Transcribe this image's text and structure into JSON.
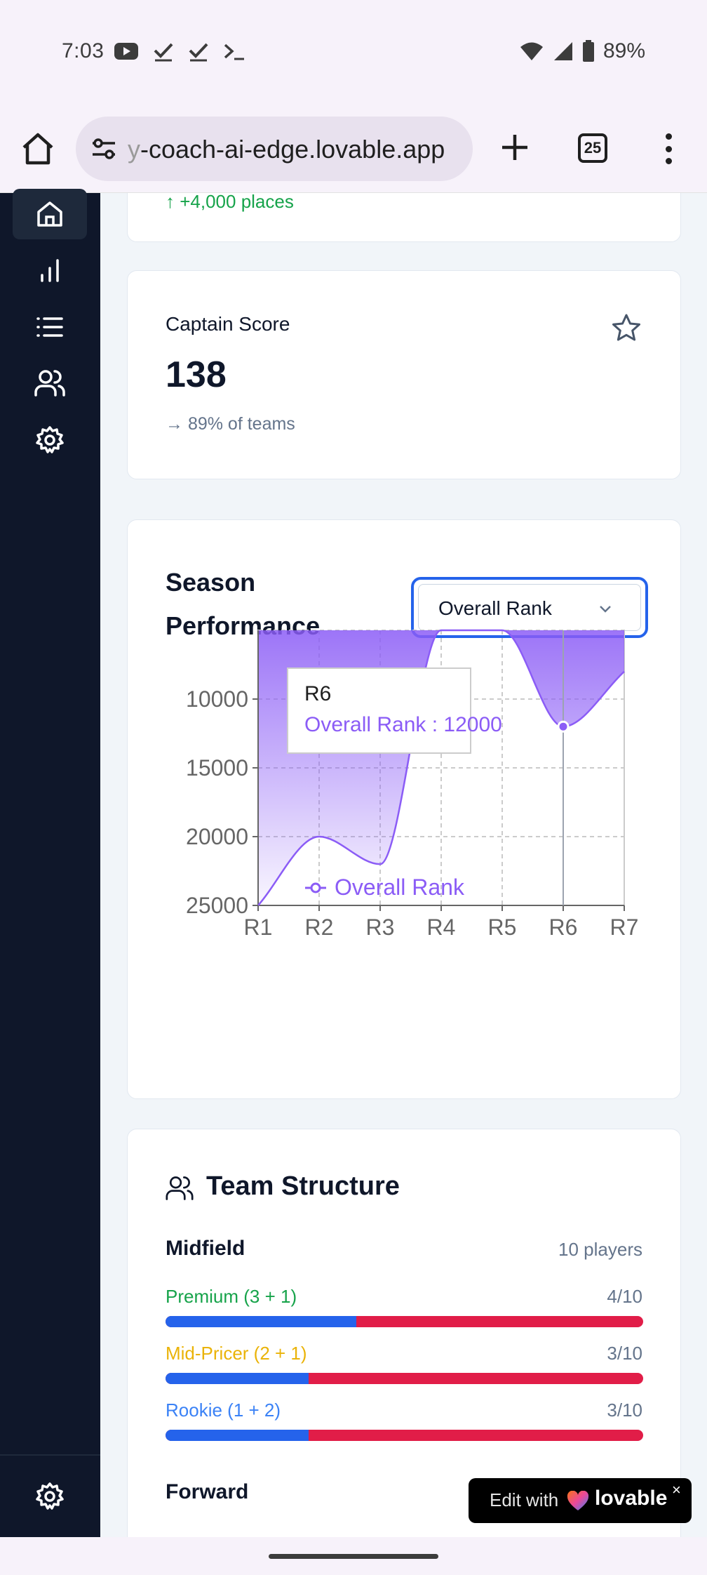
{
  "status_bar": {
    "time": "7:03",
    "battery": "89%",
    "icons": [
      "youtube-icon",
      "check-icon",
      "check-icon",
      "terminal-icon",
      "wifi-icon",
      "signal-icon",
      "battery-icon"
    ]
  },
  "browser": {
    "url_prefix": "y",
    "url_rest": "-coach-ai-edge.lovable.app",
    "tab_count": "25"
  },
  "sidebar": {
    "items": [
      {
        "icon": "home-icon",
        "active": true
      },
      {
        "icon": "bar-chart-icon",
        "active": false
      },
      {
        "icon": "list-icon",
        "active": false
      },
      {
        "icon": "users-icon",
        "active": false
      },
      {
        "icon": "settings-icon",
        "active": false
      }
    ],
    "bottom_icon": "settings-icon"
  },
  "top_card": {
    "change_text": "↑ +4,000 places"
  },
  "captain_card": {
    "label": "Captain Score",
    "value": "138",
    "sub": "→ 89% of teams"
  },
  "performance_card": {
    "title": "Season Performance",
    "select_value": "Overall Rank"
  },
  "chart_data": {
    "type": "area",
    "title": "",
    "xlabel": "",
    "ylabel": "",
    "inverted_y": true,
    "categories": [
      "R1",
      "R2",
      "R3",
      "R4",
      "R5",
      "R6",
      "R7"
    ],
    "series": [
      {
        "name": "Overall Rank",
        "values": [
          25000,
          20000,
          22000,
          5000,
          5000,
          12000,
          8000
        ],
        "color": "#8b5cf6"
      }
    ],
    "y_ticks": [
      "10000",
      "15000",
      "20000",
      "25000"
    ],
    "ylim": [
      5000,
      25000
    ],
    "grid": true,
    "legend": "bottom",
    "tooltip": {
      "title": "R6",
      "label": "Overall Rank",
      "separator": " : ",
      "value": "12000"
    }
  },
  "team_card": {
    "title": "Team Structure",
    "sections": [
      {
        "name": "Midfield",
        "count": "10 players",
        "tiers": [
          {
            "label": "Premium (3 + 1)",
            "count": "4/10",
            "fill": 0.4,
            "color": "#16a34a"
          },
          {
            "label": "Mid-Pricer (2 + 1)",
            "count": "3/10",
            "fill": 0.3,
            "color": "#eab308"
          },
          {
            "label": "Rookie (1 + 2)",
            "count": "3/10",
            "fill": 0.3,
            "color": "#3b82f6"
          }
        ]
      },
      {
        "name": "Forward"
      }
    ]
  },
  "lovable_badge": {
    "edit_text": "Edit with",
    "brand": "lovable",
    "close": "×"
  }
}
